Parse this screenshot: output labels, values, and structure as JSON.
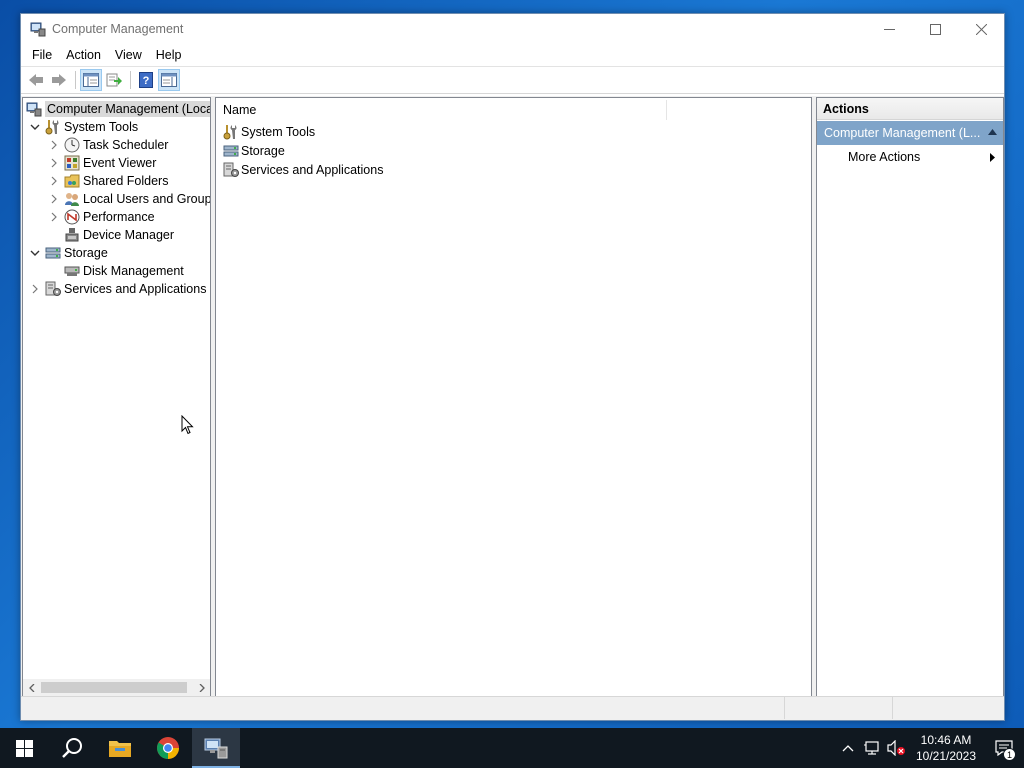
{
  "window": {
    "title": "Computer Management",
    "controls": {
      "minimize": "minimize-icon",
      "maximize": "maximize-icon",
      "close": "close-icon"
    }
  },
  "menu": [
    "File",
    "Action",
    "View",
    "Help"
  ],
  "toolbar": {
    "buttons": [
      "back-arrow-icon",
      "forward-arrow-icon",
      "show-hide-console-tree-icon",
      "export-list-icon",
      "help-icon",
      "show-hide-action-pane-icon"
    ]
  },
  "tree": {
    "items": [
      {
        "label": "Computer Management (Local",
        "level": 0,
        "expander": "none",
        "icon": "computer-management-icon",
        "selected": true
      },
      {
        "label": "System Tools",
        "level": 1,
        "expander": "expanded",
        "icon": "system-tools-icon"
      },
      {
        "label": "Task Scheduler",
        "level": 2,
        "expander": "collapsed",
        "icon": "clock-icon"
      },
      {
        "label": "Event Viewer",
        "level": 2,
        "expander": "collapsed",
        "icon": "event-viewer-icon"
      },
      {
        "label": "Shared Folders",
        "level": 2,
        "expander": "collapsed",
        "icon": "shared-folders-icon"
      },
      {
        "label": "Local Users and Groups",
        "level": 2,
        "expander": "collapsed",
        "icon": "users-icon"
      },
      {
        "label": "Performance",
        "level": 2,
        "expander": "collapsed",
        "icon": "performance-icon"
      },
      {
        "label": "Device Manager",
        "level": 2,
        "expander": "none",
        "icon": "device-manager-icon"
      },
      {
        "label": "Storage",
        "level": 1,
        "expander": "expanded",
        "icon": "storage-icon"
      },
      {
        "label": "Disk Management",
        "level": 2,
        "expander": "none",
        "icon": "disk-icon"
      },
      {
        "label": "Services and Applications",
        "level": 1,
        "expander": "collapsed",
        "icon": "services-icon"
      }
    ]
  },
  "content": {
    "column_header": "Name",
    "rows": [
      {
        "label": "System Tools",
        "icon": "system-tools-icon"
      },
      {
        "label": "Storage",
        "icon": "storage-icon"
      },
      {
        "label": "Services and Applications",
        "icon": "services-icon"
      }
    ]
  },
  "actions": {
    "header": "Actions",
    "section_title": "Computer Management (L...",
    "items": [
      "More Actions"
    ]
  },
  "taskbar": {
    "apps": [
      "start-icon",
      "search-icon",
      "file-explorer-icon",
      "chrome-icon",
      "computer-management-icon"
    ],
    "time": "10:46 AM",
    "date": "10/21/2023",
    "notification_count": "1"
  },
  "colors": {
    "accent_section": "#7fa4c9",
    "selection": "#d9d9d9",
    "taskbar": "#101820"
  }
}
